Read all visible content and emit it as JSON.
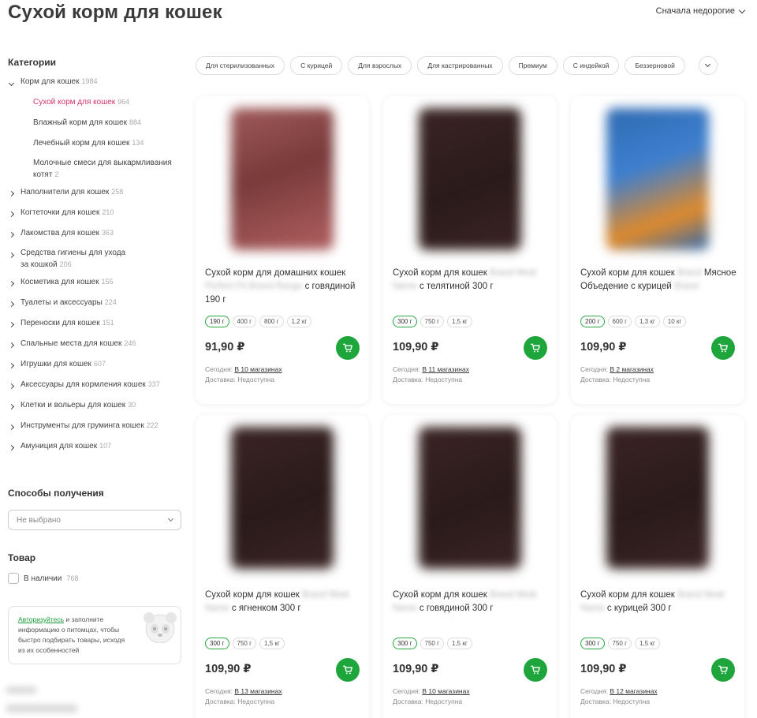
{
  "page_title": "Сухой корм для кошек",
  "sort_label": "Сначала недорогие",
  "sidebar": {
    "categories_title": "Категории",
    "categories": [
      {
        "label": "Корм для кошек",
        "count": "1984",
        "level": 0,
        "expanded": true
      },
      {
        "label": "Сухой корм для кошек",
        "count": "964",
        "level": 1,
        "active": true
      },
      {
        "label": "Влажный корм для кошек",
        "count": "884",
        "level": 1
      },
      {
        "label": "Лечебный корм для кошек",
        "count": "134",
        "level": 1
      },
      {
        "label": "Молочные смеси для выкармливания котят",
        "count": "2",
        "level": 1,
        "line1": "Молочные смеси для выкармливания",
        "line2": "котят"
      },
      {
        "label": "Наполнители для кошек",
        "count": "258",
        "level": 0
      },
      {
        "label": "Когтеточки для кошек",
        "count": "210",
        "level": 0
      },
      {
        "label": "Лакомства для кошек",
        "count": "363",
        "level": 0
      },
      {
        "label": "Средства гигиены для ухода за кошкой",
        "count": "206",
        "level": 0,
        "line1": "Средства гигиены для ухода",
        "line2": "за кошкой"
      },
      {
        "label": "Косметика для кошек",
        "count": "155",
        "level": 0
      },
      {
        "label": "Туалеты и аксессуары",
        "count": "224",
        "level": 0
      },
      {
        "label": "Переноски для кошек",
        "count": "151",
        "level": 0
      },
      {
        "label": "Спальные места для кошек",
        "count": "246",
        "level": 0
      },
      {
        "label": "Игрушки для кошек",
        "count": "607",
        "level": 0
      },
      {
        "label": "Аксессуары для кормления кошек",
        "count": "337",
        "level": 0
      },
      {
        "label": "Клетки и вольеры для кошек",
        "count": "30",
        "level": 0
      },
      {
        "label": "Инструменты для груминга кошек",
        "count": "222",
        "level": 0
      },
      {
        "label": "Амуниция для кошек",
        "count": "107",
        "level": 0
      }
    ],
    "delivery_title": "Способы получения",
    "delivery_select": "Не выбрано",
    "product_title": "Товар",
    "in_stock_label": "В наличии",
    "in_stock_count": "768",
    "auth_link": "Авторизуйтесь",
    "auth_text": " и заполните информацию о питомцах, чтобы быстро подбирать товары, исходя из их особенностей"
  },
  "chips": [
    "Для стерилизованных",
    "С курицей",
    "Для взрослых",
    "Для кастрированных",
    "Премиум",
    "С индейкой",
    "Беззерновой"
  ],
  "products": [
    {
      "title_a": "Сухой корм для домашних кошек",
      "title_blur": "Perfect Fit Brand Range",
      "title_b": "с говядиной 190 г",
      "weights": [
        "190 г",
        "400 г",
        "800 г",
        "1,2 кг"
      ],
      "price": "91,90 ₽",
      "today_label": "Сегодня:",
      "today_link": "В 10 магазинах",
      "delivery_label": "Доставка:",
      "delivery_value": "Недоступна",
      "pack_color": "#8b4a4a"
    },
    {
      "title_a": "Сухой корм для кошек",
      "title_blur": "Brand Meat Name",
      "title_b": "с телятиной 300 г",
      "weights": [
        "300 г",
        "750 г",
        "1,5 кг"
      ],
      "price": "109,90 ₽",
      "today_label": "Сегодня:",
      "today_link": "В 11 магазинах",
      "delivery_label": "Доставка:",
      "delivery_value": "Недоступна",
      "pack_color": "#3a2424"
    },
    {
      "title_a": "Сухой корм для кошек",
      "title_blur": "Brand",
      "title_b": "Мясное Объедение с курицей",
      "title_c": "Brand",
      "weights": [
        "200 г",
        "600 г",
        "1,3 кг",
        "10 кг"
      ],
      "price": "109,90 ₽",
      "today_label": "Сегодня:",
      "today_link": "В 2 магазинах",
      "delivery_label": "Доставка:",
      "delivery_value": "Недоступна",
      "pack_color": "#2f6ab0"
    },
    {
      "title_a": "Сухой корм для кошек",
      "title_blur": "Brand Meat Name",
      "title_b": "с ягненком 300 г",
      "weights": [
        "300 г",
        "750 г",
        "1,5 кг"
      ],
      "price": "109,90 ₽",
      "today_label": "Сегодня:",
      "today_link": "В 13 магазинах",
      "delivery_label": "Доставка:",
      "delivery_value": "Недоступна",
      "pack_color": "#3a2424"
    },
    {
      "title_a": "Сухой корм для кошек",
      "title_blur": "Brand Meat Name",
      "title_b": "с говядиной 300 г",
      "weights": [
        "300 г",
        "750 г",
        "1,5 кг"
      ],
      "price": "109,90 ₽",
      "today_label": "Сегодня:",
      "today_link": "В 10 магазинах",
      "delivery_label": "Доставка:",
      "delivery_value": "Недоступна",
      "pack_color": "#3a2424"
    },
    {
      "title_a": "Сухой корм для кошек",
      "title_blur": "Brand Meat Name",
      "title_b": "с курицей 300 г",
      "weights": [
        "300 г",
        "750 г",
        "1,5 кг"
      ],
      "price": "109,90 ₽",
      "today_label": "Сегодня:",
      "today_link": "В 12 магазинах",
      "delivery_label": "Доставка:",
      "delivery_value": "Недоступна",
      "pack_color": "#3a2424"
    }
  ],
  "colors": {
    "accent_green": "#1ea63c",
    "active_category": "#d2336b"
  }
}
